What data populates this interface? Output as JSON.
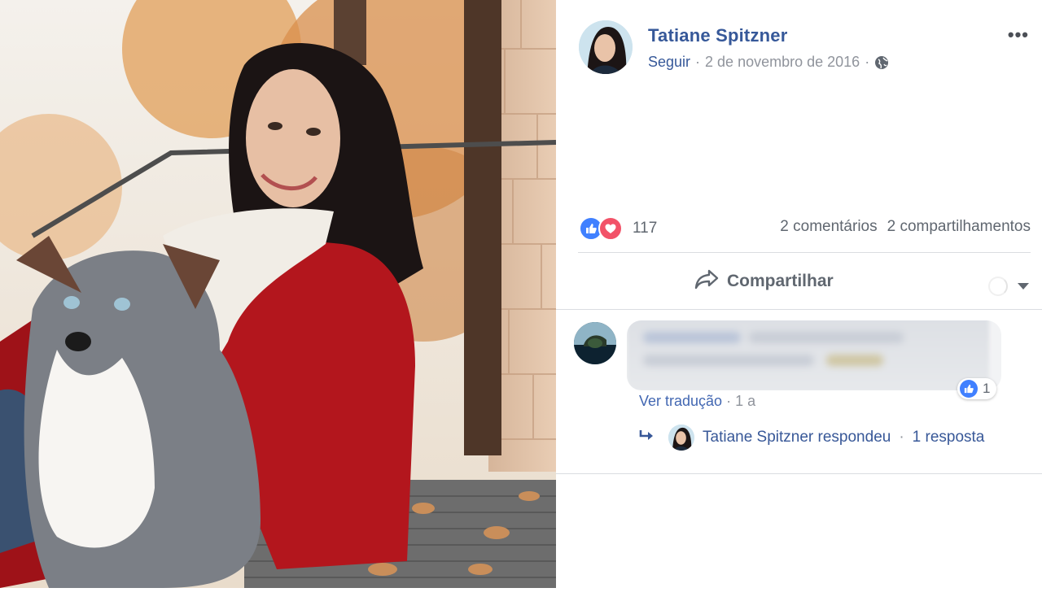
{
  "post": {
    "author": "Tatiane Spitzner",
    "follow": "Seguir",
    "sep": "·",
    "date": "2 de novembro de 2016",
    "privacy_icon": "globe-icon",
    "more_icon": "more-options-icon",
    "more_label": "•••"
  },
  "reactions": {
    "types": [
      "like",
      "love"
    ],
    "count": "117",
    "comments": "2 comentários",
    "shares": "2 compartilhamentos"
  },
  "actions": {
    "share_label": "Compartilhar"
  },
  "comment": {
    "like_count": "1",
    "translate": "Ver tradução",
    "sep": "·",
    "age": "1 a"
  },
  "reply": {
    "name_text": "Tatiane Spitzner respondeu",
    "sep": "·",
    "count_text": "1 resposta"
  },
  "colors": {
    "link": "#365899",
    "like": "#4080ff",
    "love": "#f25268",
    "muted": "#90949c"
  }
}
